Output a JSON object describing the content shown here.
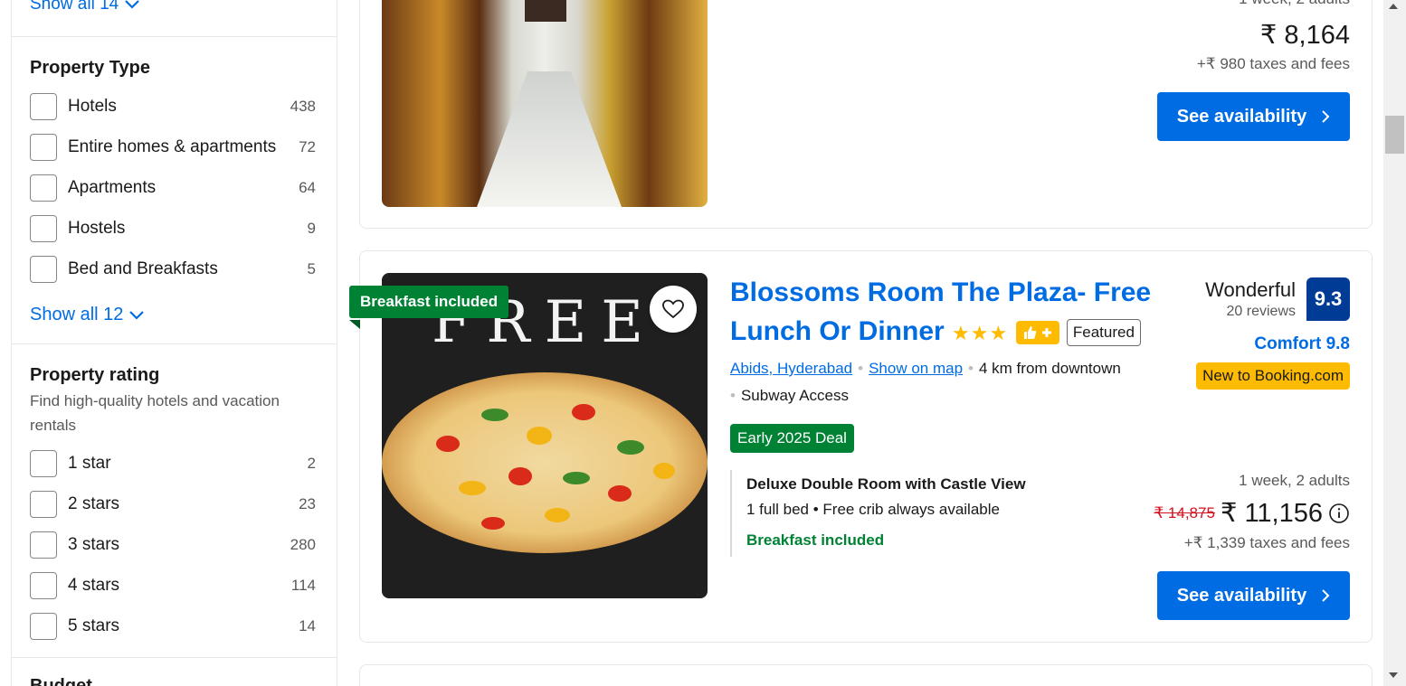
{
  "sidebar": {
    "top_show_all": "Show all 14",
    "property_type": {
      "heading": "Property Type",
      "items": [
        {
          "label": "Hotels",
          "count": "438"
        },
        {
          "label": "Entire homes & apartments",
          "count": "72"
        },
        {
          "label": "Apartments",
          "count": "64"
        },
        {
          "label": "Hostels",
          "count": "9"
        },
        {
          "label": "Bed and Breakfasts",
          "count": "5"
        }
      ],
      "show_all": "Show all 12"
    },
    "property_rating": {
      "heading": "Property rating",
      "subtitle": "Find high-quality hotels and vacation rentals",
      "items": [
        {
          "label": "1 star",
          "count": "2"
        },
        {
          "label": "2 stars",
          "count": "23"
        },
        {
          "label": "3 stars",
          "count": "280"
        },
        {
          "label": "4 stars",
          "count": "114"
        },
        {
          "label": "5 stars",
          "count": "14"
        }
      ]
    },
    "next_heading": "Budget"
  },
  "listing1": {
    "stay": "1 week, 2 adults",
    "price": "₹ 8,164",
    "taxes": "+₹ 980 taxes and fees",
    "button": "See availability"
  },
  "listing2": {
    "ribbon": "Breakfast included",
    "photo_text": "FREE",
    "title": "Blossoms Room The Plaza- Free Lunch Or Dinner",
    "stars": "★★★",
    "featured": "Featured",
    "location": "Abids, Hyderabad",
    "show_on_map": "Show on map",
    "distance": "4 km from downtown",
    "subway": "Subway Access",
    "deal": "Early 2025 Deal",
    "room_name": "Deluxe Double Room with Castle View",
    "room_desc": "1 full bed • Free crib always available",
    "room_breakfast": "Breakfast included",
    "review_word": "Wonderful",
    "review_count": "20 reviews",
    "score": "9.3",
    "comfort": "Comfort 9.8",
    "new_badge": "New to Booking.com",
    "stay": "1 week, 2 adults",
    "old_price": "₹ 14,875",
    "price": "₹ 11,156",
    "taxes": "+₹ 1,339 taxes and fees",
    "button": "See availability"
  },
  "colors": {
    "link_blue": "#006ce4",
    "score_blue": "#003b95",
    "deal_green": "#008234",
    "badge_yellow": "#febb02",
    "old_price_red": "#d4111e"
  }
}
